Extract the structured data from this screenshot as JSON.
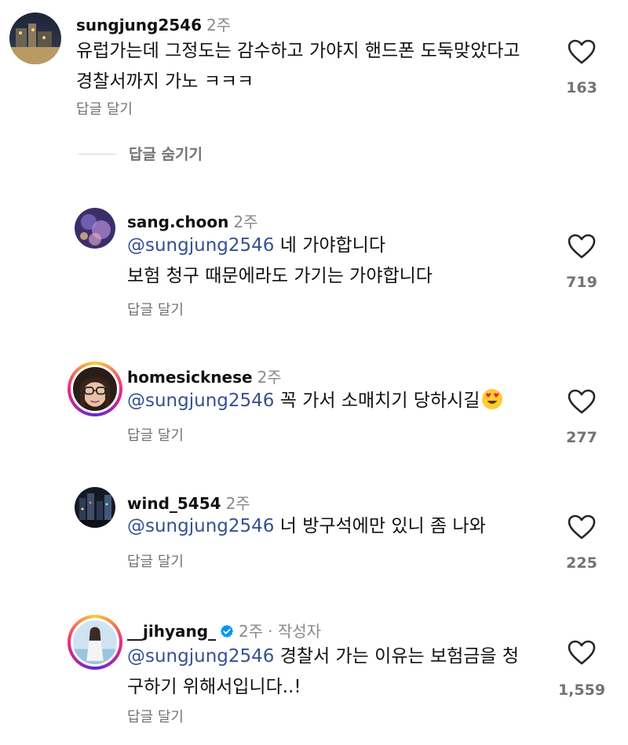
{
  "ui": {
    "reply_label": "답글 달기",
    "hide_replies_label": "답글 숨기기",
    "heart_icon": "heart-outline-icon",
    "mention_color": "#37518f",
    "verified_color": "#0095f6"
  },
  "comments": [
    {
      "username": "sungjung2546",
      "time": "2주",
      "line1": "유럽가는데 그정도는 감수하고 가야지 핸드폰 도둑맞았다고",
      "line2": "경찰서까지 가노 ㅋㅋㅋ",
      "likes": "163"
    },
    {
      "username": "sang.choon",
      "time": "2주",
      "mention": "@sungjung2546",
      "line1": " 네 가야합니다",
      "line2": "보험 청구 때문에라도 가기는 가야합니다",
      "likes": "719"
    },
    {
      "username": "homesicknese",
      "time": "2주",
      "mention": "@sungjung2546",
      "line1": " 꼭 가서 소매치기 당하시길",
      "likes": "277"
    },
    {
      "username": "wind_5454",
      "time": "2주",
      "mention": "@sungjung2546",
      "line1": " 너 방구석에만 있니 좀 나와",
      "likes": "225"
    },
    {
      "username": "__jihyang_",
      "time": "2주",
      "author_label": "· 작성자",
      "mention": "@sungjung2546",
      "line1": " 경찰서 가는 이유는 보험금을 청",
      "line2": "구하기 위해서입니다..!",
      "likes": "1,559"
    }
  ]
}
